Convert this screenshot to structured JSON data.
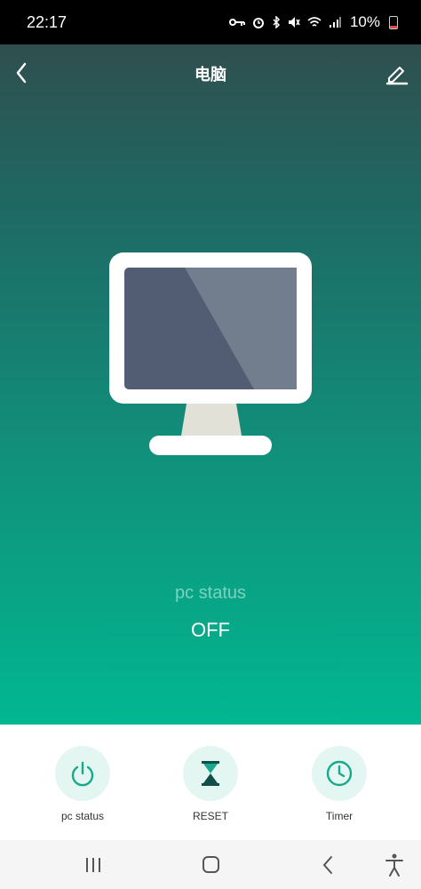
{
  "status_bar": {
    "time": "22:17",
    "battery": "10%",
    "icons": [
      "key-icon",
      "alarm-icon",
      "bluetooth-icon",
      "mute-icon",
      "wifi-icon",
      "signal-icon",
      "battery-icon"
    ]
  },
  "header": {
    "title": "电脑",
    "back_icon": "chevron-left-icon",
    "edit_icon": "pencil-icon"
  },
  "device": {
    "icon": "monitor-icon",
    "status_label": "pc status",
    "status_value": "OFF"
  },
  "actions": [
    {
      "label": "pc status",
      "icon": "power-icon"
    },
    {
      "label": "RESET",
      "icon": "hourglass-icon"
    },
    {
      "label": "Timer",
      "icon": "clock-icon"
    }
  ],
  "nav": {
    "items": [
      "recent-apps-icon",
      "home-icon",
      "back-icon",
      "accessibility-icon"
    ]
  },
  "colors": {
    "accent": "#01b791",
    "icon_tint": "#17a98c",
    "icon_bg": "#e3f6f1"
  }
}
